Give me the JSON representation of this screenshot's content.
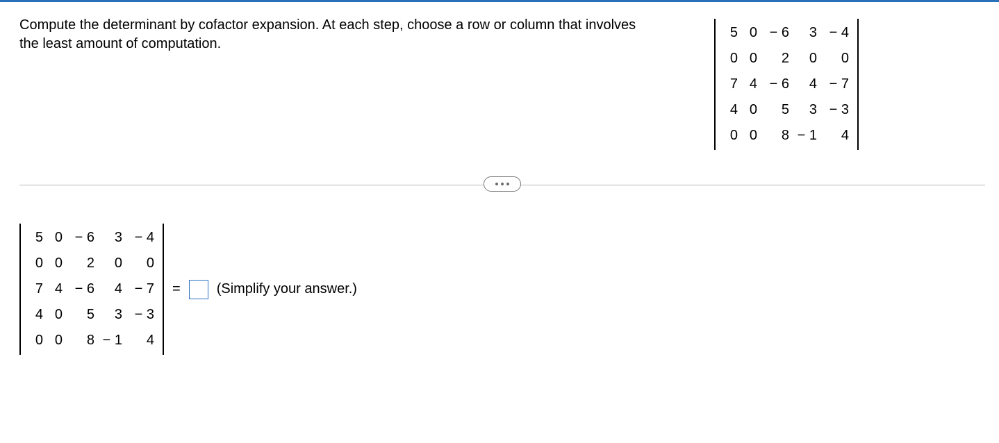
{
  "question": {
    "text": "Compute the determinant by cofactor expansion. At each step, choose a row or column that involves the least amount of computation."
  },
  "matrix_top": {
    "rows": [
      [
        "5",
        "0",
        "− 6",
        "3",
        "− 4"
      ],
      [
        "0",
        "0",
        "2",
        "0",
        "0"
      ],
      [
        "7",
        "4",
        "− 6",
        "4",
        "− 7"
      ],
      [
        "4",
        "0",
        "5",
        "3",
        "− 3"
      ],
      [
        "0",
        "0",
        "8",
        "− 1",
        "4"
      ]
    ]
  },
  "matrix_answer": {
    "rows": [
      [
        "5",
        "0",
        "− 6",
        "3",
        "− 4"
      ],
      [
        "0",
        "0",
        "2",
        "0",
        "0"
      ],
      [
        "7",
        "4",
        "− 6",
        "4",
        "− 7"
      ],
      [
        "4",
        "0",
        "5",
        "3",
        "− 3"
      ],
      [
        "0",
        "0",
        "8",
        "− 1",
        "4"
      ]
    ]
  },
  "equals": "=",
  "answer_value": "",
  "hint": "(Simplify your answer.)"
}
